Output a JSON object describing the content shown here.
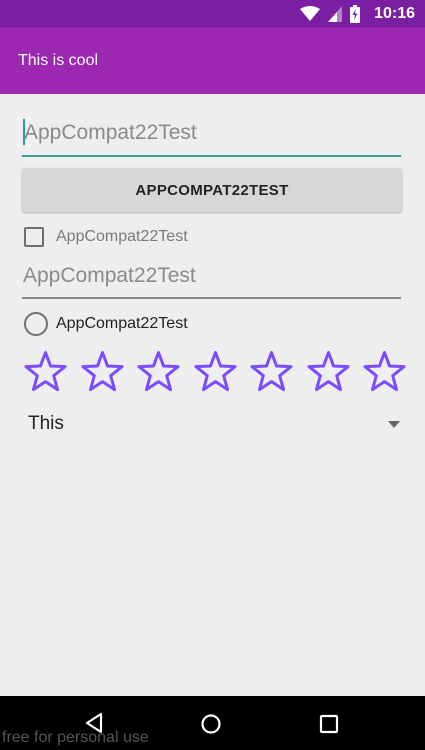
{
  "status_bar": {
    "time": "10:16",
    "icons": [
      "wifi-icon",
      "signal-icon",
      "battery-charging-icon"
    ]
  },
  "action_bar": {
    "title": "This is cool"
  },
  "edit_text_1": {
    "hint": "AppCompat22Test",
    "focused": true
  },
  "button": {
    "label": "APPCOMPAT22TEST"
  },
  "checkbox": {
    "label": "AppCompat22Test",
    "checked": false
  },
  "edit_text_2": {
    "hint": "AppCompat22Test"
  },
  "radio": {
    "label": "AppCompat22Test",
    "checked": false
  },
  "rating": {
    "stars": 7,
    "value": 0,
    "color": "#7c4dff"
  },
  "spinner": {
    "selected": "This"
  },
  "nav_bar": {
    "icons": [
      "back-icon",
      "home-icon",
      "recents-icon"
    ]
  },
  "watermark": "free for personal use",
  "colors": {
    "primary": "#9c27b0",
    "primary_dark": "#7b1fa2",
    "accent": "#3f9a8f",
    "background": "#eeeeee"
  }
}
